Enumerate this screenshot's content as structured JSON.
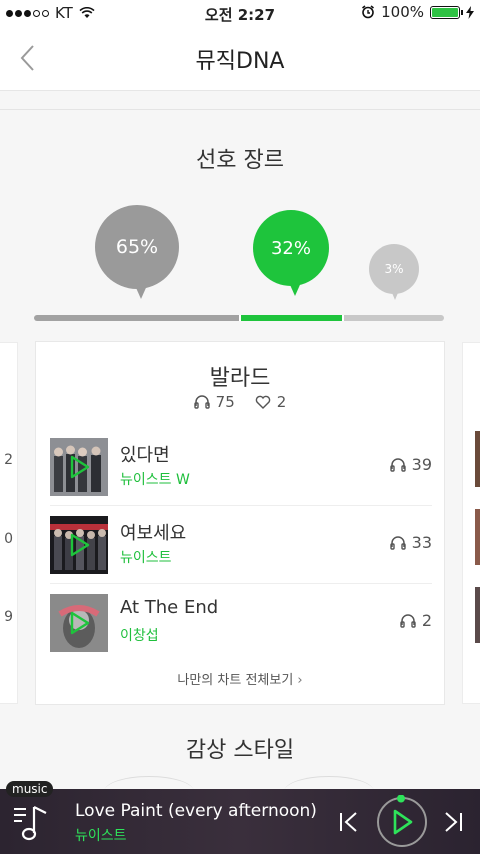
{
  "status": {
    "carrier": "KT",
    "time": "오전 2:27",
    "battery": "100%"
  },
  "nav": {
    "title": "뮤직DNA"
  },
  "genre_section": {
    "title": "선호 장르",
    "bubbles": [
      {
        "label": "65%",
        "value": 65,
        "color": "#9a9a9a"
      },
      {
        "label": "32%",
        "value": 32,
        "color": "#1ec43c"
      },
      {
        "label": "3%",
        "value": 3,
        "color": "#c8c8c8"
      }
    ]
  },
  "card": {
    "genre": "발라드",
    "listen_count": "75",
    "like_count": "2",
    "songs": [
      {
        "title": "있다면",
        "artist": "뉴이스트 W",
        "count": "39"
      },
      {
        "title": "여보세요",
        "artist": "뉴이스트",
        "count": "33"
      },
      {
        "title": "At The End",
        "artist": "이창섭",
        "count": "2"
      }
    ],
    "view_all": "나만의 차트 전체보기"
  },
  "style_section": {
    "title": "감상 스타일"
  },
  "player": {
    "tag": "music",
    "song": "Love Paint (every afternoon)",
    "artist": "뉴이스트"
  }
}
